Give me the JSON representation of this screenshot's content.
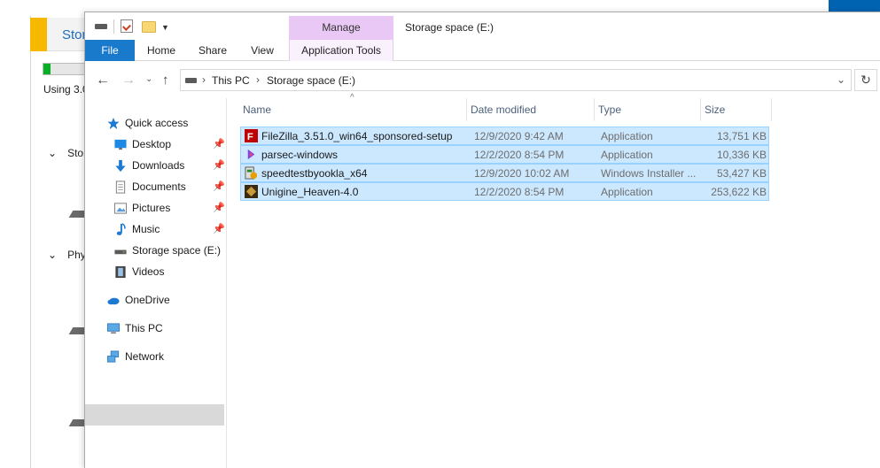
{
  "background": {
    "tab_text": "Stor",
    "progress_fraction": 0.16,
    "using_text": "Using 3.0",
    "sections": [
      "Stor",
      "Phy"
    ]
  },
  "titlebar": {
    "manage_label": "Manage",
    "title": "Storage space (E:)"
  },
  "ribbon": {
    "tabs": [
      "File",
      "Home",
      "Share",
      "View",
      "Application Tools"
    ]
  },
  "address": {
    "crumbs": [
      "This PC",
      "Storage space (E:)"
    ]
  },
  "nav": {
    "items": [
      {
        "label": "Quick access",
        "icon": "star-icon",
        "pinned": false
      },
      {
        "label": "Desktop",
        "icon": "desktop-icon",
        "pinned": true
      },
      {
        "label": "Downloads",
        "icon": "download-arrow-icon",
        "pinned": true
      },
      {
        "label": "Documents",
        "icon": "documents-icon",
        "pinned": true
      },
      {
        "label": "Pictures",
        "icon": "pictures-icon",
        "pinned": true
      },
      {
        "label": "Music",
        "icon": "music-note-icon",
        "pinned": true
      },
      {
        "label": "Storage space (E:)",
        "icon": "drive-icon",
        "pinned": false
      },
      {
        "label": "Videos",
        "icon": "videos-icon",
        "pinned": false
      },
      {
        "label": "OneDrive",
        "icon": "cloud-icon",
        "pinned": false
      },
      {
        "label": "This PC",
        "icon": "computer-icon",
        "pinned": false
      },
      {
        "label": "Network",
        "icon": "network-icon",
        "pinned": false
      }
    ],
    "selected": "This PC"
  },
  "columns": [
    "Name",
    "Date modified",
    "Type",
    "Size"
  ],
  "files": [
    {
      "name": "FileZilla_3.51.0_win64_sponsored-setup",
      "date": "12/9/2020 9:42 AM",
      "type": "Application",
      "size": "13,751 KB",
      "icon": "filezilla-icon"
    },
    {
      "name": "parsec-windows",
      "date": "12/2/2020 8:54 PM",
      "type": "Application",
      "size": "10,336 KB",
      "icon": "parsec-icon"
    },
    {
      "name": "speedtestbyookla_x64",
      "date": "12/9/2020 10:02 AM",
      "type": "Windows Installer ...",
      "size": "53,427 KB",
      "icon": "installer-icon"
    },
    {
      "name": "Unigine_Heaven-4.0",
      "date": "12/2/2020 8:54 PM",
      "type": "Application",
      "size": "253,622 KB",
      "icon": "unigine-icon"
    }
  ]
}
